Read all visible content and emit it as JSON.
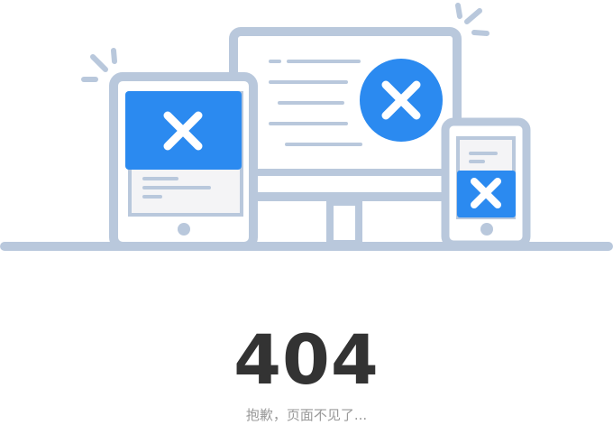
{
  "error": {
    "code": "404",
    "message": "抱歉，页面不见了..."
  },
  "colors": {
    "outline": "#b9c8dc",
    "accent": "#2b8af0",
    "screen_fill": "#f4f4f6",
    "text_dark": "#333333",
    "text_muted": "#999999"
  },
  "illustration": {
    "devices": [
      "monitor-icon",
      "tablet-icon",
      "phone-icon"
    ],
    "error_marks": [
      "close-icon",
      "close-icon",
      "close-icon"
    ]
  }
}
